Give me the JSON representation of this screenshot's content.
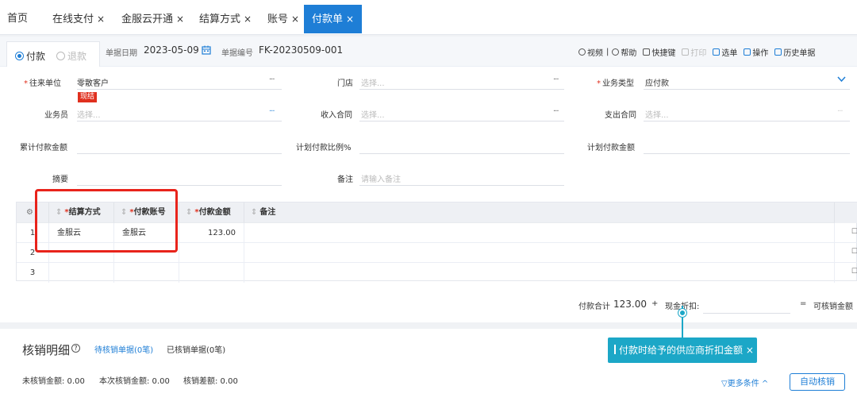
{
  "tabs": [
    {
      "label": "首页",
      "closable": false
    },
    {
      "label": "在线支付",
      "closable": true
    },
    {
      "label": "金服云开通",
      "closable": true
    },
    {
      "label": "结算方式",
      "closable": true
    },
    {
      "label": "账号",
      "closable": true
    },
    {
      "label": "付款单",
      "closable": true,
      "active": true
    }
  ],
  "close_glyph": "×",
  "header": {
    "type_pay": "付款",
    "type_refund": "退款",
    "date_label": "单据日期",
    "date_value": "2023-05-09",
    "number_label": "单据编号",
    "number_value": "FK-20230509-001"
  },
  "toolbar": {
    "video": "视频",
    "separator": "|",
    "help": "帮助",
    "shortcut": "快捷键",
    "print": "打印",
    "select_bill": "选单",
    "operate": "操作",
    "history": "历史单据"
  },
  "form": {
    "counterparty_label": "往来单位",
    "counterparty_value": "零散客户",
    "counterparty_badge": "现结",
    "store_label": "门店",
    "store_placeholder": "选择...",
    "biztype_label": "业务类型",
    "biztype_value": "应付款",
    "salesman_label": "业务员",
    "salesman_placeholder": "选择...",
    "income_contract_label": "收入合同",
    "income_contract_placeholder": "选择...",
    "expense_contract_label": "支出合同",
    "expense_contract_placeholder": "选择...",
    "cumulative_label": "累计付款金额",
    "plan_ratio_label": "计划付款比例%",
    "plan_amount_label": "计划付款金额",
    "summary_label": "摘要",
    "remark_label": "备注",
    "remark_placeholder": "请输入备注",
    "more_glyph": "···"
  },
  "grid": {
    "columns": [
      "结算方式",
      "付款账号",
      "付款金额",
      "备注"
    ],
    "required_mark": "*",
    "rows": [
      {
        "no": "1",
        "settle": "金服云",
        "account": "金服云",
        "amount": "123.00",
        "remark": ""
      },
      {
        "no": "2",
        "settle": "",
        "account": "",
        "amount": "",
        "remark": ""
      },
      {
        "no": "3",
        "settle": "",
        "account": "",
        "amount": "",
        "remark": ""
      }
    ]
  },
  "totals": {
    "paid_label": "付款合计",
    "paid_value": "123.00",
    "plus": "+",
    "discount_label": "现金折扣:",
    "equals": "=",
    "verifiable_label": "可核销金额"
  },
  "tooltip": {
    "text": "付款时给予的供应商折扣金额",
    "close": "×"
  },
  "verify": {
    "title": "核销明细",
    "pending_link": "待核销单据(0笔)",
    "done_link": "已核销单据(0笔)",
    "unverified_amount": "未核销金额: 0.00",
    "current_amount": "本次核销金额: 0.00",
    "diff": "核销差额: 0.00",
    "more_conditions": "更多条件",
    "auto_button": "自动核销"
  },
  "colors": {
    "accent": "#1e7ed6",
    "required": "#e0301e",
    "highlight_box": "#e8231b",
    "tooltip": "#1ca7c7"
  }
}
